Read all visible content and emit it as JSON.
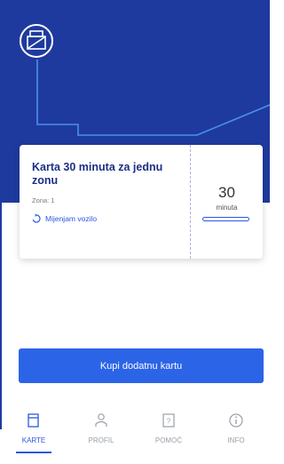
{
  "colors": {
    "hero": "#1f3a9e",
    "accent": "#2c64e8",
    "title": "#1b2f86",
    "inactive": "#9aa0a8"
  },
  "header": {
    "logo_icon": "transit-ticket-logo-icon"
  },
  "ticket": {
    "title": "Karta 30 minuta za jednu zonu",
    "zone": "Zona: 1",
    "status": "Mijenjam vozilo",
    "status_icon": "refresh-icon",
    "minutes_value": "30",
    "minutes_unit": "minuta",
    "progress": 0.0
  },
  "buy_button": {
    "label": "Kupi dodatnu kartu"
  },
  "tabs": [
    {
      "label": "KARTE",
      "icon": "ticket-icon",
      "active": true
    },
    {
      "label": "PROFIL",
      "icon": "user-icon",
      "active": false
    },
    {
      "label": "POMOĆ",
      "icon": "help-icon",
      "active": false
    },
    {
      "label": "INFO",
      "icon": "info-icon",
      "active": false
    }
  ]
}
